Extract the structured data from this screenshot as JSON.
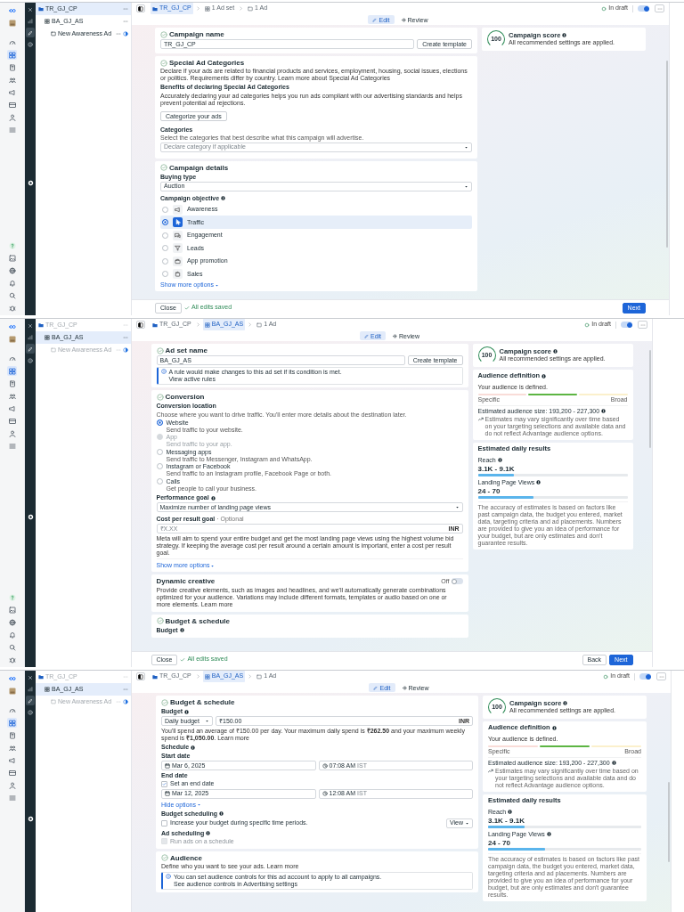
{
  "screens": [
    {
      "rail": {
        "top": [
          {
            "selected": false
          },
          {
            "selected": false
          },
          {
            "selected": false
          },
          {
            "selected": true
          },
          {
            "selected": false
          },
          {
            "selected": false
          },
          {
            "selected": false
          },
          {
            "selected": false
          },
          {
            "selected": false
          },
          {
            "selected": false
          }
        ],
        "bottom": [
          {
            "selected": false
          },
          {
            "selected": false
          },
          {
            "selected": false
          },
          {
            "selected": false
          },
          {
            "selected": false
          },
          {
            "selected": false
          }
        ]
      },
      "tools": [
        {
          "selected": false
        },
        {
          "selected": false
        },
        {
          "selected": true
        },
        {
          "selected": false
        }
      ],
      "tree": [
        {
          "label": "TR_GJ_CP",
          "selected": true,
          "dimmed": false,
          "children": [
            {
              "label": "BA_GJ_AS",
              "selected": false,
              "dimmed": false,
              "children": [
                {
                  "label": "New Awareness Ad",
                  "selected": false,
                  "dimmed": false
                }
              ]
            }
          ]
        }
      ],
      "breadcrumb": [
        {
          "label": "TR_GJ_CP",
          "selected": true
        },
        {
          "label": "1 Ad set",
          "selected": false
        },
        {
          "label": "1 Ad",
          "selected": false
        }
      ],
      "status": {
        "label": "In draft",
        "on": true
      },
      "tabs": [
        {
          "label": "Edit",
          "selected": true
        },
        {
          "label": "Review",
          "selected": false
        }
      ],
      "cards": [
        {
          "title": "Campaign name",
          "done": true,
          "blocks": [
            {
              "kind": "input",
              "value": "TR_GJ_CP",
              "button": "Create template"
            }
          ]
        },
        {
          "title": "Special Ad Categories",
          "done": true,
          "blocks": [
            {
              "kind": "text",
              "text": "Declare if your ads are related to financial products and services, employment, housing, social issues, elections or politics. Requirements differ by country.",
              "link": "Learn more about Special Ad Categories"
            },
            {
              "kind": "label",
              "text": "Benefits of declaring Special Ad Categories"
            },
            {
              "kind": "text",
              "text": "Accurately declaring your ad categories helps you run ads compliant with our advertising standards and helps prevent potential ad rejections."
            },
            {
              "kind": "button",
              "text": "Categorize your ads"
            },
            {
              "kind": "label",
              "text": "Categories"
            },
            {
              "kind": "hint",
              "text": "Select the categories that best describe what this campaign will advertise."
            },
            {
              "kind": "select",
              "placeholder": "Declare category if applicable"
            }
          ]
        },
        {
          "title": "Campaign details",
          "done": true,
          "blocks": [
            {
              "kind": "label",
              "text": "Buying type"
            },
            {
              "kind": "select",
              "value": "Auction"
            },
            {
              "kind": "label",
              "text": "Campaign objective",
              "info": true
            },
            {
              "kind": "objective",
              "label": "Awareness",
              "selected": false
            },
            {
              "kind": "objective",
              "label": "Traffic",
              "selected": true
            },
            {
              "kind": "objective",
              "label": "Engagement",
              "selected": false
            },
            {
              "kind": "objective",
              "label": "Leads",
              "selected": false
            },
            {
              "kind": "objective",
              "label": "App promotion",
              "selected": false
            },
            {
              "kind": "objective",
              "label": "Sales",
              "selected": false
            },
            {
              "kind": "link",
              "text": "Show more options"
            }
          ]
        }
      ],
      "side": [
        {
          "kind": "score",
          "value": "100",
          "title": "Campaign score",
          "info": true,
          "text": "All recommended settings are applied."
        }
      ],
      "footer": {
        "close": "Close",
        "saved": "All edits saved",
        "buttons": [
          {
            "label": "Next",
            "primary": true
          }
        ]
      }
    },
    {
      "rail": {
        "top": [
          {
            "selected": false
          },
          {
            "selected": false
          },
          {
            "selected": false
          },
          {
            "selected": true
          },
          {
            "selected": false
          },
          {
            "selected": false
          },
          {
            "selected": false
          },
          {
            "selected": false
          },
          {
            "selected": false
          },
          {
            "selected": false
          }
        ],
        "bottom": [
          {
            "selected": false
          },
          {
            "selected": false
          },
          {
            "selected": false
          },
          {
            "selected": false
          },
          {
            "selected": false
          },
          {
            "selected": false
          }
        ]
      },
      "tools": [
        {
          "selected": false
        },
        {
          "selected": false
        },
        {
          "selected": true
        },
        {
          "selected": false
        }
      ],
      "tree": [
        {
          "label": "TR_GJ_CP",
          "selected": false,
          "dimmed": true,
          "children": [
            {
              "label": "BA_GJ_AS",
              "selected": true,
              "dimmed": false,
              "children": [
                {
                  "label": "New Awareness Ad",
                  "selected": false,
                  "dimmed": true
                }
              ]
            }
          ]
        }
      ],
      "breadcrumb": [
        {
          "label": "TR_GJ_CP",
          "selected": false
        },
        {
          "label": "BA_GJ_AS",
          "selected": true
        },
        {
          "label": "1 Ad",
          "selected": false
        }
      ],
      "status": {
        "label": "In draft",
        "on": true
      },
      "tabs": [
        {
          "label": "Edit",
          "selected": true
        },
        {
          "label": "Review",
          "selected": false
        }
      ],
      "cards": [
        {
          "title": "Ad set name",
          "done": true,
          "blocks": [
            {
              "kind": "input",
              "value": "BA_GJ_AS",
              "button": "Create template"
            },
            {
              "kind": "notice",
              "text": "A rule would make changes to this ad set if its condition is met.",
              "link": "View active rules"
            }
          ]
        },
        {
          "title": "Conversion",
          "done": true,
          "blocks": [
            {
              "kind": "label",
              "text": "Conversion location"
            },
            {
              "kind": "hint",
              "text": "Choose where you want to drive traffic. You'll enter more details about the destination later."
            },
            {
              "kind": "radio",
              "label": "Website",
              "sub": "Send traffic to your website.",
              "selected": true,
              "disabled": false
            },
            {
              "kind": "radio",
              "label": "App",
              "sub": "Send traffic to your app.",
              "selected": false,
              "disabled": true
            },
            {
              "kind": "radio",
              "label": "Messaging apps",
              "sub": "Send traffic to Messenger, Instagram and WhatsApp.",
              "selected": false,
              "disabled": false
            },
            {
              "kind": "radio",
              "label": "Instagram or Facebook",
              "sub": "Send traffic to an Instagram profile, Facebook Page or both.",
              "selected": false,
              "disabled": false
            },
            {
              "kind": "radio",
              "label": "Calls",
              "sub": "Get people to call your business.",
              "selected": false,
              "disabled": false
            },
            {
              "kind": "label",
              "text": "Performance goal",
              "info": true
            },
            {
              "kind": "select",
              "value": "Maximize number of landing page views"
            },
            {
              "kind": "label",
              "text": "Cost per result goal",
              "note": "· Optional"
            },
            {
              "kind": "input",
              "placeholder": "₹X.XX",
              "suffix": "INR"
            },
            {
              "kind": "text",
              "text": "Meta will aim to spend your entire budget and get the most landing page views using the highest volume bid strategy. If keeping the average cost per result around a certain amount is important, enter a cost per result goal."
            },
            {
              "kind": "divider"
            },
            {
              "kind": "link",
              "text": "Show more options"
            }
          ]
        },
        {
          "title": "Dynamic creative",
          "done": false,
          "toggle": {
            "label": "Off",
            "on": false
          },
          "blocks": [
            {
              "kind": "text",
              "text": "Provide creative elements, such as images and headlines, and we'll automatically generate combinations optimized for your audience. Variations may include different formats, templates or audio based on one or more elements.",
              "link": "Learn more"
            }
          ]
        },
        {
          "title": "Budget & schedule",
          "done": true,
          "blocks": [
            {
              "kind": "label",
              "text": "Budget",
              "info": true
            }
          ]
        }
      ],
      "side": [
        {
          "kind": "score",
          "value": "100",
          "title": "Campaign score",
          "info": true,
          "text": "All recommended settings are applied."
        },
        {
          "kind": "audience",
          "title": "Audience definition",
          "info": true,
          "subtitle": "Your audience is defined.",
          "segments": [
            {
              "selected": false
            },
            {
              "selected": true
            },
            {
              "selected": false
            }
          ],
          "left": "Specific",
          "right": "Broad",
          "size": "Estimated audience size: 193,200 - 227,300",
          "note": "Estimates may vary significantly over time based on your targeting selections and available data and do not reflect Advantage audience options."
        },
        {
          "kind": "results",
          "title": "Estimated daily results",
          "metrics": [
            {
              "label": "Reach",
              "value": "3.1K - 9.1K",
              "level": 0.24
            },
            {
              "label": "Landing Page Views",
              "value": "24 - 70",
              "level": 0.37
            }
          ],
          "note": "The accuracy of estimates is based on factors like past campaign data, the budget you entered, market data, targeting criteria and ad placements. Numbers are provided to give you an idea of performance for your budget, but are only estimates and don't guarantee results."
        }
      ],
      "footer": {
        "close": "Close",
        "saved": "All edits saved",
        "buttons": [
          {
            "label": "Back",
            "primary": false
          },
          {
            "label": "Next",
            "primary": true
          }
        ]
      }
    },
    {
      "rail": {
        "top": [
          {
            "selected": false
          },
          {
            "selected": false
          },
          {
            "selected": false
          },
          {
            "selected": true
          },
          {
            "selected": false
          },
          {
            "selected": false
          },
          {
            "selected": false
          },
          {
            "selected": false
          },
          {
            "selected": false
          },
          {
            "selected": false
          }
        ]
      },
      "tools": [
        {
          "selected": false
        },
        {
          "selected": false
        },
        {
          "selected": true
        },
        {
          "selected": false
        }
      ],
      "tree": [
        {
          "label": "TR_GJ_CP",
          "selected": false,
          "dimmed": true,
          "children": [
            {
              "label": "BA_GJ_AS",
              "selected": true,
              "dimmed": false,
              "children": [
                {
                  "label": "New Awareness Ad",
                  "selected": false,
                  "dimmed": true
                }
              ]
            }
          ]
        }
      ],
      "breadcrumb": [
        {
          "label": "TR_GJ_CP",
          "selected": false
        },
        {
          "label": "BA_GJ_AS",
          "selected": true
        },
        {
          "label": "1 Ad",
          "selected": false
        }
      ],
      "status": {
        "label": "In draft",
        "on": true
      },
      "tabs": [
        {
          "label": "Edit",
          "selected": true
        },
        {
          "label": "Review",
          "selected": false
        }
      ],
      "cards": [
        {
          "title": "Budget & schedule",
          "done": true,
          "blocks": [
            {
              "kind": "label",
              "text": "Budget",
              "info": true
            },
            {
              "kind": "budget",
              "select": "Daily budget",
              "value": "₹150.00",
              "suffix": "INR"
            },
            {
              "kind": "text",
              "text": "You'll spend an average of ₹150.00 per day. Your maximum daily spend is **₹262.50** and your maximum weekly spend is **₹1,050.00**.",
              "link": "Learn more"
            },
            {
              "kind": "label",
              "text": "Schedule",
              "info": true
            },
            {
              "kind": "label",
              "text": "Start date"
            },
            {
              "kind": "datetime",
              "date": "Mar 6, 2025",
              "time": "07:08 AM",
              "zone": "IST"
            },
            {
              "kind": "label",
              "text": "End date"
            },
            {
              "kind": "checkbox",
              "label": "Set an end date",
              "checked": true,
              "disabled": false
            },
            {
              "kind": "datetime",
              "date": "Mar 12, 2025",
              "time": "12:08 AM",
              "zone": "IST"
            },
            {
              "kind": "link",
              "text": "Hide options"
            },
            {
              "kind": "label",
              "text": "Budget scheduling",
              "info": true
            },
            {
              "kind": "checkbox",
              "label": "Increase your budget during specific time periods.",
              "checked": false,
              "disabled": false,
              "button": "View"
            },
            {
              "kind": "label",
              "text": "Ad scheduling",
              "info": true
            },
            {
              "kind": "checkbox",
              "label": "Run ads on a schedule",
              "checked": false,
              "disabled": true
            }
          ]
        },
        {
          "title": "Audience",
          "done": true,
          "blocks": [
            {
              "kind": "text",
              "text": "Define who you want to see your ads.",
              "link": "Learn more"
            },
            {
              "kind": "notice",
              "text": "You can set audience controls for this ad account to apply to all campaigns.",
              "link": "See audience controls in Advertising settings"
            }
          ]
        }
      ],
      "side": [
        {
          "kind": "score",
          "value": "100",
          "title": "Campaign score",
          "info": true,
          "text": "All recommended settings are applied."
        },
        {
          "kind": "audience",
          "title": "Audience definition",
          "info": true,
          "subtitle": "Your audience is defined.",
          "segments": [
            {
              "selected": false
            },
            {
              "selected": true
            },
            {
              "selected": false
            }
          ],
          "left": "Specific",
          "right": "Broad",
          "size": "Estimated audience size: 193,200 - 227,300",
          "note": "Estimates may vary significantly over time based on your targeting selections and available data and do not reflect Advantage audience options."
        },
        {
          "kind": "results",
          "title": "Estimated daily results",
          "metrics": [
            {
              "label": "Reach",
              "value": "3.1K - 9.1K",
              "level": 0.24
            },
            {
              "label": "Landing Page Views",
              "value": "24 - 70",
              "level": 0.37
            }
          ],
          "note": "The accuracy of estimates is based on factors like past campaign data, the budget you entered, market data, targeting criteria and ad placements. Numbers are provided to give you an idea of performance for your budget, but are only estimates and don't guarantee results."
        }
      ]
    }
  ]
}
